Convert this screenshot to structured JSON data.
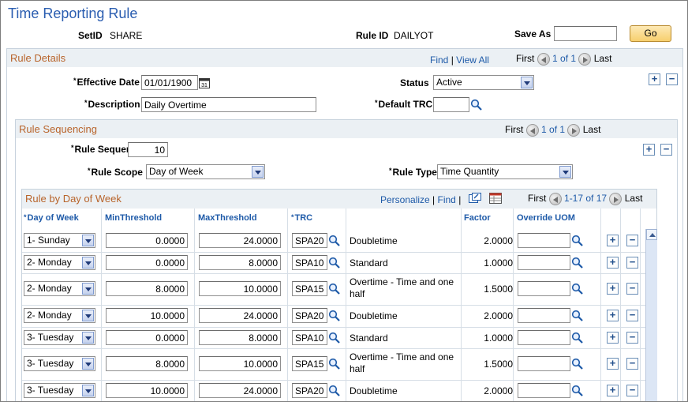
{
  "page": {
    "title": "Time Reporting Rule",
    "setid_label": "SetID",
    "setid_value": "SHARE",
    "ruleid_label": "Rule ID",
    "ruleid_value": "DAILYOT",
    "saveas_label": "Save As",
    "saveas_value": "",
    "go_label": "Go"
  },
  "rule_details": {
    "title": "Rule Details",
    "find": "Find",
    "sep": "|",
    "view_all": "View All",
    "first": "First",
    "count": "1 of 1",
    "last": "Last",
    "effdt_label": "Effective Date",
    "effdt_value": "01/01/1900",
    "status_label": "Status",
    "status_value": "Active",
    "desc_label": "Description",
    "desc_value": "Daily Overtime",
    "trc_label": "Default TRC",
    "trc_value": "",
    "required_mark": "*",
    "calendar_icon_text": "31"
  },
  "rule_sequencing": {
    "title": "Rule Sequencing",
    "first": "First",
    "count": "1 of 1",
    "last": "Last",
    "seq_label": "Rule Sequence",
    "seq_value": "10",
    "scope_label": "Rule Scope",
    "scope_value": "Day of Week",
    "type_label": "Rule Type",
    "type_value": "Time Quantity"
  },
  "grid": {
    "title": "Rule by Day of Week",
    "personalize": "Personalize",
    "sep": "|",
    "find": "Find",
    "first": "First",
    "count": "1-17 of 17",
    "last": "Last",
    "headers": {
      "day": "Day of Week",
      "min": "MinThreshold",
      "max": "MaxThreshold",
      "trc": "TRC",
      "factor": "Factor",
      "uom": "Override UOM"
    },
    "rows": [
      {
        "day": "1- Sunday",
        "min": "0.0000",
        "max": "24.0000",
        "trc": "SPA20",
        "desc": "Doubletime",
        "factor": "2.0000",
        "uom": ""
      },
      {
        "day": "2- Monday",
        "min": "0.0000",
        "max": "8.0000",
        "trc": "SPA10",
        "desc": "Standard",
        "factor": "1.0000",
        "uom": ""
      },
      {
        "day": "2- Monday",
        "min": "8.0000",
        "max": "10.0000",
        "trc": "SPA15",
        "desc": "Overtime - Time and one half",
        "factor": "1.5000",
        "uom": ""
      },
      {
        "day": "2- Monday",
        "min": "10.0000",
        "max": "24.0000",
        "trc": "SPA20",
        "desc": "Doubletime",
        "factor": "2.0000",
        "uom": ""
      },
      {
        "day": "3- Tuesday",
        "min": "0.0000",
        "max": "8.0000",
        "trc": "SPA10",
        "desc": "Standard",
        "factor": "1.0000",
        "uom": ""
      },
      {
        "day": "3- Tuesday",
        "min": "8.0000",
        "max": "10.0000",
        "trc": "SPA15",
        "desc": "Overtime - Time and one half",
        "factor": "1.5000",
        "uom": ""
      },
      {
        "day": "3- Tuesday",
        "min": "10.0000",
        "max": "24.0000",
        "trc": "SPA20",
        "desc": "Doubletime",
        "factor": "2.0000",
        "uom": ""
      }
    ]
  },
  "buttons": {
    "add": "+",
    "remove": "−"
  },
  "colors": {
    "title": "#2a5db0",
    "section_title": "#b8642b",
    "link": "#1e5aa8",
    "header_bg": "#ebf0f4",
    "go_button": "#f7cf6e"
  },
  "icons": [
    "calendar-icon",
    "search-icon",
    "arrow-left-icon",
    "arrow-right-icon",
    "add-row-icon",
    "delete-row-icon",
    "dropdown-icon",
    "zoom-icon",
    "download-icon",
    "scroll-up-icon"
  ]
}
